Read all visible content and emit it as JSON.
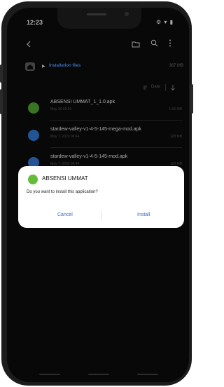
{
  "status_bar": {
    "time": "12:23",
    "left_icons": "G ⊑",
    "right_icons": "⚙ ▾ ▮"
  },
  "appbar": {
    "back_icon": "back-icon",
    "folder_icon": "folder-icon",
    "search_icon": "search-icon",
    "more_icon": "more-vert-icon"
  },
  "breadcrumb": {
    "home_icon": "home-icon",
    "path": "Installation files",
    "total_size": "387 MB"
  },
  "sortbar": {
    "sort_label": "Date"
  },
  "files": [
    {
      "name": "ABSENSI UMMAT_1_1.0.apk",
      "date": "May 30 09:01",
      "size": "1.06 MB",
      "icon_color": "#4d9b2f"
    },
    {
      "name": "stardew-valley-v1-4-5-145-mega-mod.apk",
      "date": "May 7, 2020 06:44",
      "size": "128 MB",
      "icon_color": "#2f72c7"
    },
    {
      "name": "stardew-valley-v1-4-5-145-mod.apk",
      "date": "May 7, 2020 06:44",
      "size": "128 MB",
      "icon_color": "#2f72c7"
    }
  ],
  "dialog": {
    "title": "ABSENSI UMMAT",
    "message": "Do you want to install this application?",
    "cancel_label": "Cancel",
    "install_label": "Install"
  }
}
